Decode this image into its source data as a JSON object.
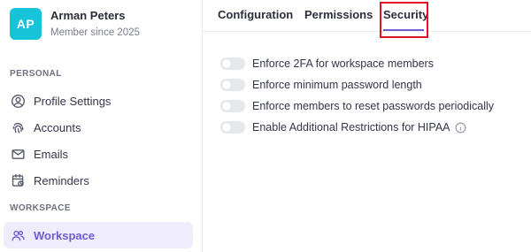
{
  "profile": {
    "initials": "AP",
    "name": "Arman Peters",
    "subtitle": "Member since 2025",
    "avatar_color": "#17c3d8"
  },
  "sections": {
    "personal": "PERSONAL",
    "workspace": "WORKSPACE"
  },
  "nav": {
    "profile_settings": {
      "label": "Profile Settings",
      "icon": "user-circle-icon"
    },
    "accounts": {
      "label": "Accounts",
      "icon": "fingerprint-icon"
    },
    "emails": {
      "label": "Emails",
      "icon": "mail-icon"
    },
    "reminders": {
      "label": "Reminders",
      "icon": "calendar-clock-icon"
    },
    "workspace": {
      "label": "Workspace",
      "icon": "users-icon",
      "active": true
    }
  },
  "tabs": {
    "configuration": "Configuration",
    "permissions": "Permissions",
    "security": "Security",
    "active": "Security"
  },
  "security_options": [
    {
      "label": "Enforce 2FA for workspace members",
      "enabled": false
    },
    {
      "label": "Enforce minimum password length",
      "enabled": false
    },
    {
      "label": "Enforce members to reset passwords periodically",
      "enabled": false
    },
    {
      "label": "Enable Additional Restrictions for HIPAA",
      "enabled": false,
      "info_icon": "info-icon"
    }
  ],
  "colors": {
    "accent": "#6c5dd3",
    "active_nav_bg": "#efedfb",
    "highlight_box": "#e0102a",
    "toggle_off": "#e7e8ec"
  }
}
